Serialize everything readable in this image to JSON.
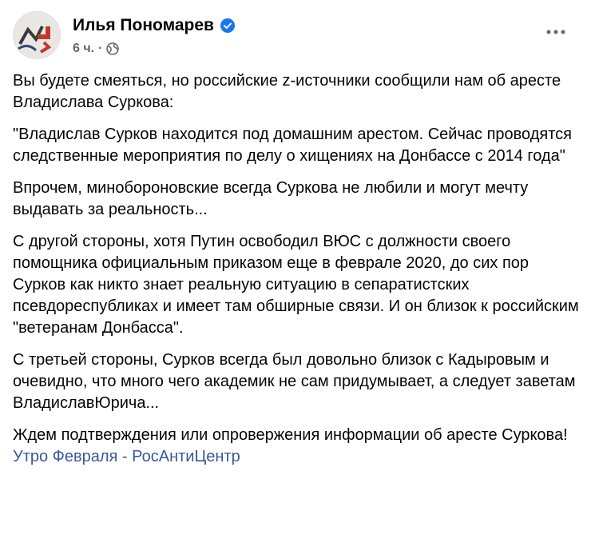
{
  "post": {
    "author": "Илья Пономарев",
    "timestamp": "6 ч.",
    "separator": "·",
    "verified_color": "#1877f2",
    "link_color": "#385898",
    "paragraphs": [
      "Вы будете смеяться, но российские z-источники сообщили нам об аресте Владислава Суркова:",
      "\"Владислав Сурков находится под домашним арестом. Сейчас проводятся следственные мероприятия по делу о хищениях на Донбассе с 2014 года\"",
      "Впрочем, минобороновские всегда Суркова не любили и могут мечту выдавать за реальность...",
      "С другой стороны, хотя Путин освободил ВЮС с должности своего помощника официальным приказом еще в феврале 2020, до сих пор Сурков как никто знает реальную ситуацию в сепаратистских псевдореспубликах и имеет там обширные связи. И он близок к российским \"ветеранам Донбасса\".",
      "С третьей стороны, Сурков всегда был довольно близок с Кадыровым и очевидно, что много чего академик не сам придумывает, а следует заветам ВладиславЮрича...",
      "Ждем подтверждения или опровержения информации об аресте Суркова!"
    ],
    "link_text": "Утро Февраля - РосАнтиЦентр"
  }
}
